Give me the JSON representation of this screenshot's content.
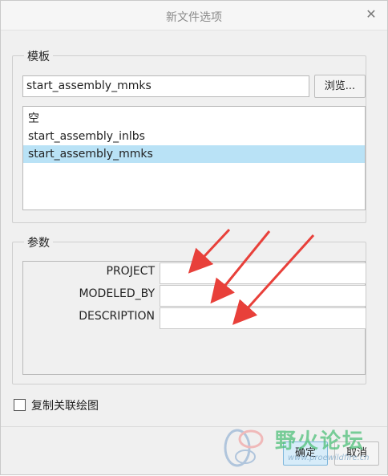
{
  "dialog": {
    "title": "新文件选项",
    "close_icon": "close-icon"
  },
  "template_group": {
    "legend": "模板",
    "selected_template_value": "start_assembly_mmks",
    "browse_label": "浏览...",
    "list_items": [
      "空",
      "start_assembly_inlbs",
      "start_assembly_mmks"
    ],
    "selected_index": 2
  },
  "params_group": {
    "legend": "参数",
    "rows": [
      {
        "label": "PROJECT",
        "value": ""
      },
      {
        "label": "MODELED_BY",
        "value": ""
      },
      {
        "label": "DESCRIPTION",
        "value": ""
      }
    ]
  },
  "copy_drawing": {
    "label": "复制关联绘图",
    "checked": false
  },
  "footer": {
    "ok_label": "确定",
    "cancel_label": "取消"
  },
  "watermark": {
    "text": "野火论坛",
    "url": "www.proewildfire.cn"
  },
  "colors": {
    "selection": "#b9e2f6",
    "arrow": "#e8403a"
  }
}
